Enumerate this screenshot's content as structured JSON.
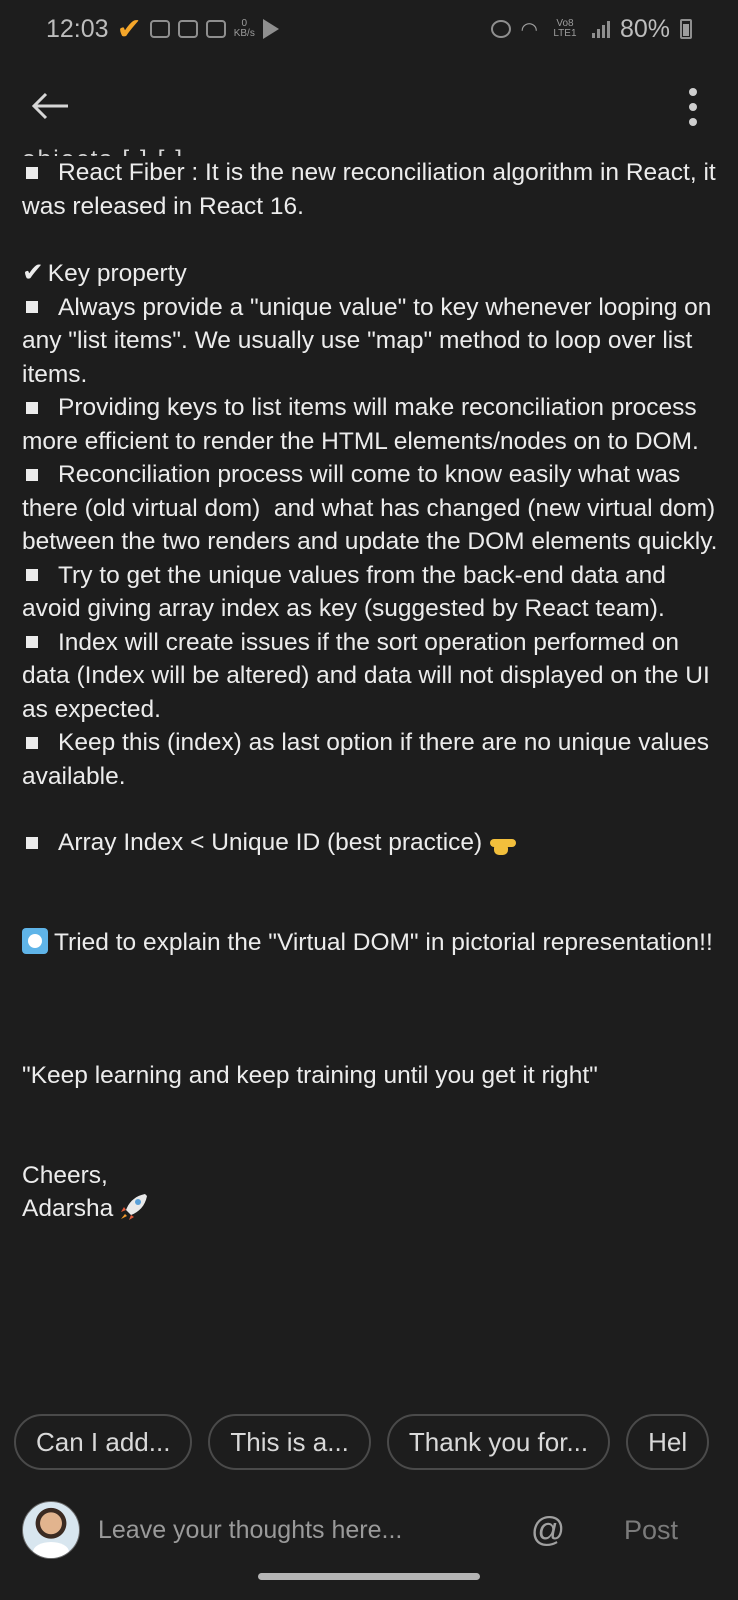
{
  "status_bar": {
    "time": "12:03",
    "kb_value": "0",
    "kb_unit": "KB/s",
    "network_label": "Vo8 LTE1",
    "battery": "80%"
  },
  "content": {
    "cut_top_line": "objects [ ] [ ]",
    "fiber": "React Fiber : It is the new reconciliation algorithm in React, it was released in React 16.",
    "key_heading": "Key property",
    "key_bullets": [
      "Always provide a \"unique value\" to key whenever looping on any \"list items\". We usually use \"map\" method to loop over list items.",
      "Providing keys to list items will make reconciliation process more efficient to render the HTML elements/nodes on to DOM.",
      "Reconciliation process will come to know easily what was there (old virtual dom)  and what has changed (new virtual dom) between the two renders and update the DOM elements quickly.",
      "Try to get the unique values from the back-end data and avoid giving array index as key (suggested by React team).",
      "Index will create issues if the sort operation performed on data (Index will be altered) and data will not displayed on the UI as expected.",
      "Keep this (index) as last option if there are no unique values available."
    ],
    "array_index": "Array Index < Unique ID (best practice)",
    "pictorial": "Tried to explain the \"Virtual DOM\" in pictorial representation!!",
    "quote": "\"Keep learning and keep training until you get it right\"",
    "cheers": "Cheers,",
    "author": "Adarsha"
  },
  "suggestions": [
    "Can I add...",
    "This is a...",
    "Thank you for...",
    "Hel"
  ],
  "comment": {
    "placeholder": "Leave your thoughts here...",
    "mention_symbol": "@",
    "post_label": "Post"
  },
  "colors": {
    "background": "#1d1d1d",
    "text": "#ececec",
    "accent_check": "#f4a62a"
  }
}
